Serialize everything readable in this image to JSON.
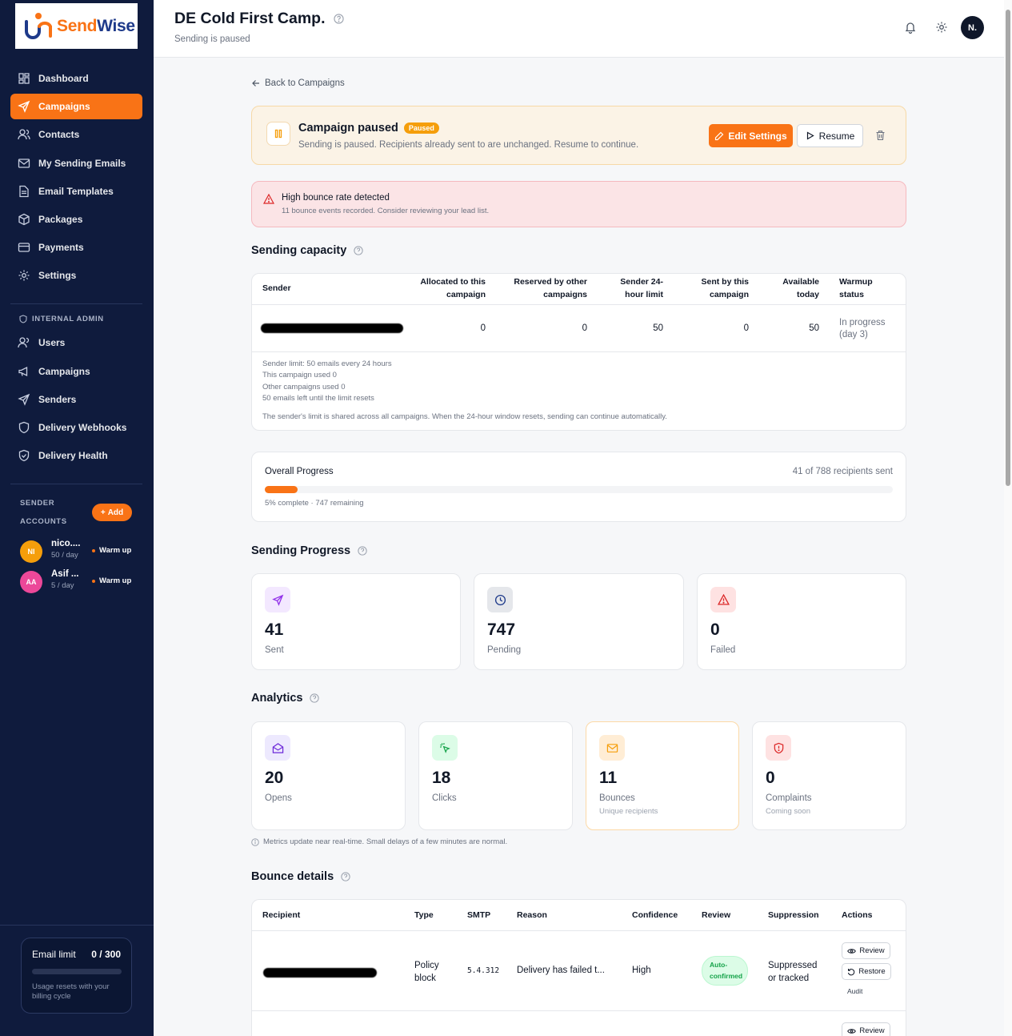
{
  "brand": {
    "part1": "Send",
    "part2": "Wise"
  },
  "sidebar": {
    "items": [
      {
        "label": "Dashboard"
      },
      {
        "label": "Campaigns"
      },
      {
        "label": "Contacts"
      },
      {
        "label": "My Sending Emails"
      },
      {
        "label": "Email Templates"
      },
      {
        "label": "Packages"
      },
      {
        "label": "Payments"
      },
      {
        "label": "Settings"
      }
    ],
    "admin_label": "INTERNAL ADMIN",
    "admin_items": [
      {
        "label": "Users"
      },
      {
        "label": "Campaigns"
      },
      {
        "label": "Senders"
      },
      {
        "label": "Delivery Webhooks"
      },
      {
        "label": "Delivery Health"
      }
    ],
    "sender_label_1": "SENDER",
    "sender_label_2": "ACCOUNTS",
    "add_label": "Add",
    "accounts": [
      {
        "initials": "NI",
        "name": "nico....",
        "rate": "50 / day",
        "status": "Warm up",
        "color": "#f59e0b"
      },
      {
        "initials": "AA",
        "name": "Asif ...",
        "rate": "5 / day",
        "status": "Warm up",
        "color": "#ec4899"
      }
    ],
    "email_limit": {
      "label": "Email limit",
      "value": "0 / 300",
      "note": "Usage resets with your billing cycle"
    }
  },
  "header": {
    "title": "DE Cold First Camp.",
    "subtitle": "Sending is paused",
    "avatar": "N."
  },
  "back_label": "Back to Campaigns",
  "paused_banner": {
    "title": "Campaign paused",
    "badge": "Paused",
    "text": "Sending is paused. Recipients already sent to are unchanged. Resume to continue.",
    "edit_label": "Edit Settings",
    "resume_label": "Resume"
  },
  "alert": {
    "title": "High bounce rate detected",
    "text": "11 bounce events recorded. Consider reviewing your lead list."
  },
  "capacity": {
    "heading": "Sending capacity",
    "columns": {
      "sender": "Sender",
      "allocated": [
        "Allocated to this",
        "campaign"
      ],
      "reserved": [
        "Reserved by other",
        "campaigns"
      ],
      "limit24": [
        "Sender 24-",
        "hour limit"
      ],
      "sent": [
        "Sent by this",
        "campaign"
      ],
      "available": [
        "Available",
        "today"
      ],
      "warmup": [
        "Warmup",
        "status"
      ]
    },
    "row": {
      "allocated": "0",
      "reserved": "0",
      "limit24": "50",
      "sent": "0",
      "available": "50",
      "warmup": [
        "In progress",
        "(day 3)"
      ]
    },
    "notes": [
      "Sender limit: 50 emails every 24 hours",
      "This campaign used 0",
      "Other campaigns used 0",
      "50 emails left until the limit resets"
    ],
    "footer": "The sender's limit is shared across all campaigns. When the 24-hour window resets, sending can continue automatically."
  },
  "progress": {
    "label": "Overall Progress",
    "count": "41 of 788 recipients sent",
    "fraction": 0.052,
    "detail": "5% complete · 747 remaining"
  },
  "sending_progress": {
    "heading": "Sending Progress",
    "cards": [
      {
        "value": "41",
        "label": "Sent"
      },
      {
        "value": "747",
        "label": "Pending"
      },
      {
        "value": "0",
        "label": "Failed"
      }
    ]
  },
  "analytics": {
    "heading": "Analytics",
    "cards": [
      {
        "value": "20",
        "label": "Opens",
        "sub": ""
      },
      {
        "value": "18",
        "label": "Clicks",
        "sub": ""
      },
      {
        "value": "11",
        "label": "Bounces",
        "sub": "Unique recipients"
      },
      {
        "value": "0",
        "label": "Complaints",
        "sub": "Coming soon"
      }
    ],
    "note": "Metrics update near real-time. Small delays of a few minutes are normal."
  },
  "bounce": {
    "heading": "Bounce details",
    "columns": {
      "recipient": "Recipient",
      "type": "Type",
      "smtp": "SMTP",
      "reason": "Reason",
      "confidence": "Confidence",
      "review": "Review",
      "suppression": "Suppression",
      "actions": "Actions"
    },
    "rows": [
      {
        "type": [
          "Policy",
          "block"
        ],
        "smtp": "5.4.312",
        "reason": "Delivery has failed t...",
        "confidence": "High",
        "review": [
          "Auto-",
          "confirmed"
        ],
        "suppression": [
          "Suppressed",
          "or tracked"
        ],
        "review_btn": "Review",
        "restore_btn": "Restore",
        "audit": "Audit"
      }
    ],
    "next_review_btn": "Review"
  }
}
